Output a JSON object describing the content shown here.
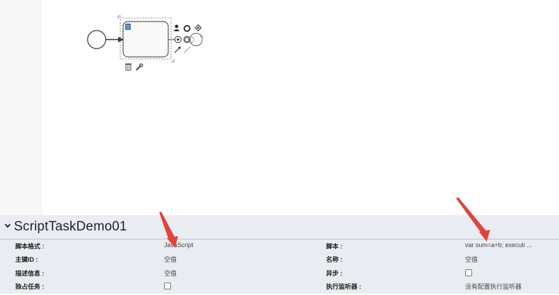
{
  "process": {
    "name": "ScriptTaskDemo01"
  },
  "canvas": {
    "start_event": "start-event",
    "script_task": "script-task",
    "context_pad": [
      "user-task-icon",
      "end-event-icon",
      "gateway-icon",
      "intermediate-event-icon",
      "connection-arrow-icon",
      "delete-icon",
      "wrench-icon"
    ]
  },
  "properties": {
    "rows": [
      {
        "left_label": "脚本格式 :",
        "left_value": "JavaScript",
        "right_label": "脚本 :",
        "right_value": "var sum=a+b; executi ..."
      },
      {
        "left_label": "主键ID :",
        "left_value": "空值",
        "right_label": "名称 :",
        "right_value": "空值"
      },
      {
        "left_label": "描述信息 :",
        "left_value": "空值",
        "right_label": "异步 :",
        "right_checkbox": false
      },
      {
        "left_label": "独占任务 :",
        "left_checkbox": false,
        "right_label": "执行监听器 :",
        "right_value": "没有配置执行监听器"
      }
    ]
  },
  "colors": {
    "panel_bg": "#e9ecf1",
    "task_fill": "#f9f9f9",
    "annotation_arrow": "#e0443a",
    "script_icon": "#2d6fb3"
  }
}
